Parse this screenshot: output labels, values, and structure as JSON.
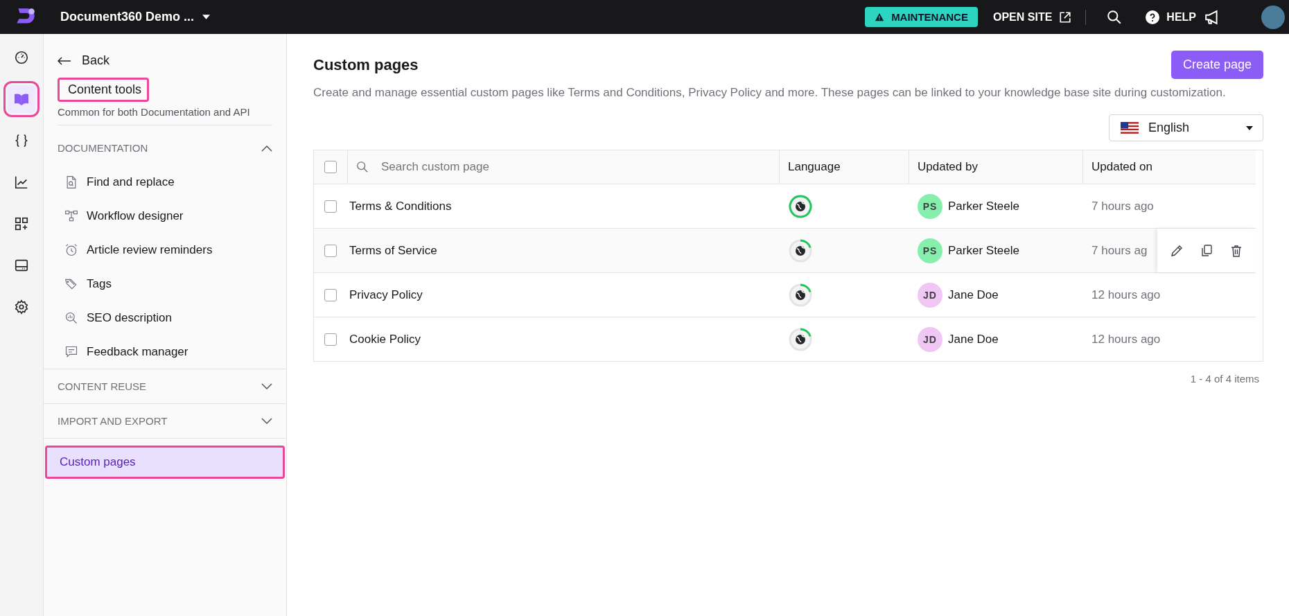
{
  "topbar": {
    "project": "Document360 Demo ...",
    "maintenance": "MAINTENANCE",
    "open_site": "OPEN SITE",
    "help": "HELP"
  },
  "rail": [
    {
      "kind": "dashboard",
      "selected": false,
      "highlighted": false
    },
    {
      "kind": "book",
      "selected": true,
      "highlighted": true
    },
    {
      "kind": "braces",
      "selected": false,
      "highlighted": false
    },
    {
      "kind": "chart",
      "selected": false,
      "highlighted": false
    },
    {
      "kind": "apps",
      "selected": false,
      "highlighted": false
    },
    {
      "kind": "drive",
      "selected": false,
      "highlighted": false
    },
    {
      "kind": "settings",
      "selected": false,
      "highlighted": false
    }
  ],
  "sidebar": {
    "back": "Back",
    "title": "Content tools",
    "title_highlighted": true,
    "subtitle": "Common for both Documentation and API",
    "sections": [
      {
        "label": "DOCUMENTATION",
        "expanded": true,
        "items": [
          {
            "kind": "find",
            "label": "Find and replace"
          },
          {
            "kind": "workflow",
            "label": "Workflow designer"
          },
          {
            "kind": "alarm",
            "label": "Article review reminders"
          },
          {
            "kind": "tag",
            "label": "Tags"
          },
          {
            "kind": "seo",
            "label": "SEO description"
          },
          {
            "kind": "feedback",
            "label": "Feedback manager"
          }
        ]
      },
      {
        "label": "CONTENT REUSE",
        "expanded": false
      },
      {
        "label": "IMPORT AND EXPORT",
        "expanded": false
      }
    ],
    "custom_pages": {
      "label": "Custom pages",
      "selected": true,
      "highlighted": true
    }
  },
  "main": {
    "title": "Custom pages",
    "create_button": "Create page",
    "description": "Create and manage essential custom pages like Terms and Conditions, Privacy Policy and more. These pages can be linked to your knowledge base site during customization.",
    "language": "English",
    "table": {
      "all_checked": false,
      "search_placeholder": "Search custom page",
      "columns": [
        "Language",
        "Updated by",
        "Updated on"
      ],
      "rows": [
        {
          "name": "Terms & Conditions",
          "checked": false,
          "translation_complete": true,
          "initials": "PS",
          "color": "#86efac",
          "user": "Parker Steele",
          "updated_on": "7 hours ago",
          "hovered": false
        },
        {
          "name": "Terms of Service",
          "checked": false,
          "translation_complete": false,
          "initials": "PS",
          "color": "#86efac",
          "user": "Parker Steele",
          "updated_on": "7 hours ag",
          "hovered": true
        },
        {
          "name": "Privacy Policy",
          "checked": false,
          "translation_complete": false,
          "initials": "JD",
          "color": "#f0c6f5",
          "user": "Jane Doe",
          "updated_on": "12 hours ago",
          "hovered": false
        },
        {
          "name": "Cookie Policy",
          "checked": false,
          "translation_complete": false,
          "initials": "JD",
          "color": "#f0c6f5",
          "user": "Jane Doe",
          "updated_on": "12 hours ago",
          "hovered": false
        }
      ]
    },
    "pagination": "1 - 4 of 4 items"
  }
}
